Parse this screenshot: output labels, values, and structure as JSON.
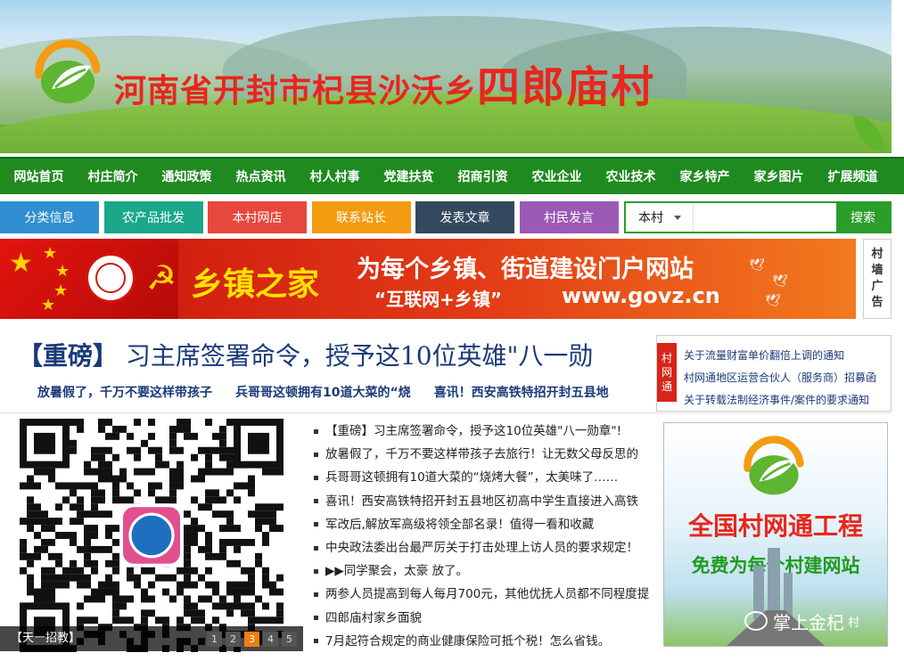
{
  "site": {
    "title_part1": "河南省开封市杞县沙沃乡",
    "title_part2": "四郎庙村"
  },
  "nav": [
    "网站首页",
    "村庄简介",
    "通知政策",
    "热点资讯",
    "村人村事",
    "党建扶贫",
    "招商引资",
    "农业企业",
    "农业技术",
    "家乡特产",
    "家乡图片",
    "扩展频道"
  ],
  "subnav": [
    {
      "label": "分类信息",
      "color": "#2f8fd0"
    },
    {
      "label": "农产品批发",
      "color": "#1aa78a"
    },
    {
      "label": "本村网店",
      "color": "#e8473d"
    },
    {
      "label": "联系站长",
      "color": "#f39c12"
    },
    {
      "label": "发表文章",
      "color": "#34495e"
    },
    {
      "label": "村民发言",
      "color": "#9b59b6"
    }
  ],
  "search": {
    "scope": "本村",
    "placeholder": "",
    "button": "搜索"
  },
  "ad": {
    "brand": "乡镇之家",
    "slogan": "为每个乡镇、街道建设门户网站",
    "sub": "“互联网+乡镇”",
    "url": "www.govz.cn"
  },
  "village_ad_tag": [
    "村",
    "墙",
    "广",
    "告"
  ],
  "headline": {
    "prefix": "【重磅】",
    "text": "习主席签署命令，授予这10位英雄\"八一勋"
  },
  "subheads": [
    "放暑假了，千万不要这样带孩子",
    "兵哥哥这顿拥有10道大菜的“烧",
    "喜讯！西安高铁特招开封五县地"
  ],
  "notice": {
    "tag": [
      "村",
      "网",
      "通"
    ],
    "items": [
      "关于流量财富单价翻倍上调的通知",
      "村网通地区运营合伙人（服务商）招募函",
      "关于转载法制经济事件/案件的要求通知"
    ]
  },
  "slider": {
    "caption": "【天一招教】",
    "pages": [
      "1",
      "2",
      "3",
      "4",
      "5"
    ],
    "active": 2
  },
  "news": [
    "【重磅】习主席签署命令，授予这10位英雄\"八一勋章\"!",
    "放暑假了，千万不要这样带孩子去旅行！让无数父母反思的",
    "兵哥哥这顿拥有10道大菜的“烧烤大餐”，太美味了……",
    "喜讯！西安高铁特招开封五县地区初高中学生直接进入高铁",
    "军改后,解放军高级将领全部名录！值得一看和收藏",
    "中央政法委出台最严厉关于打击处理上访人员的要求规定！",
    "▶▶同学聚会，太豪 放了。",
    "两参人员提高到每人每月700元，其他优抚人员都不同程度提",
    "四郎庙村家乡面貌",
    "7月起符合规定的商业健康保险可抵个税！怎么省钱。"
  ],
  "promo": {
    "title": "全国村网通工程",
    "subtitle": "免费为每个村建网站",
    "wechat": "掌上金杞",
    "corner": "村"
  }
}
